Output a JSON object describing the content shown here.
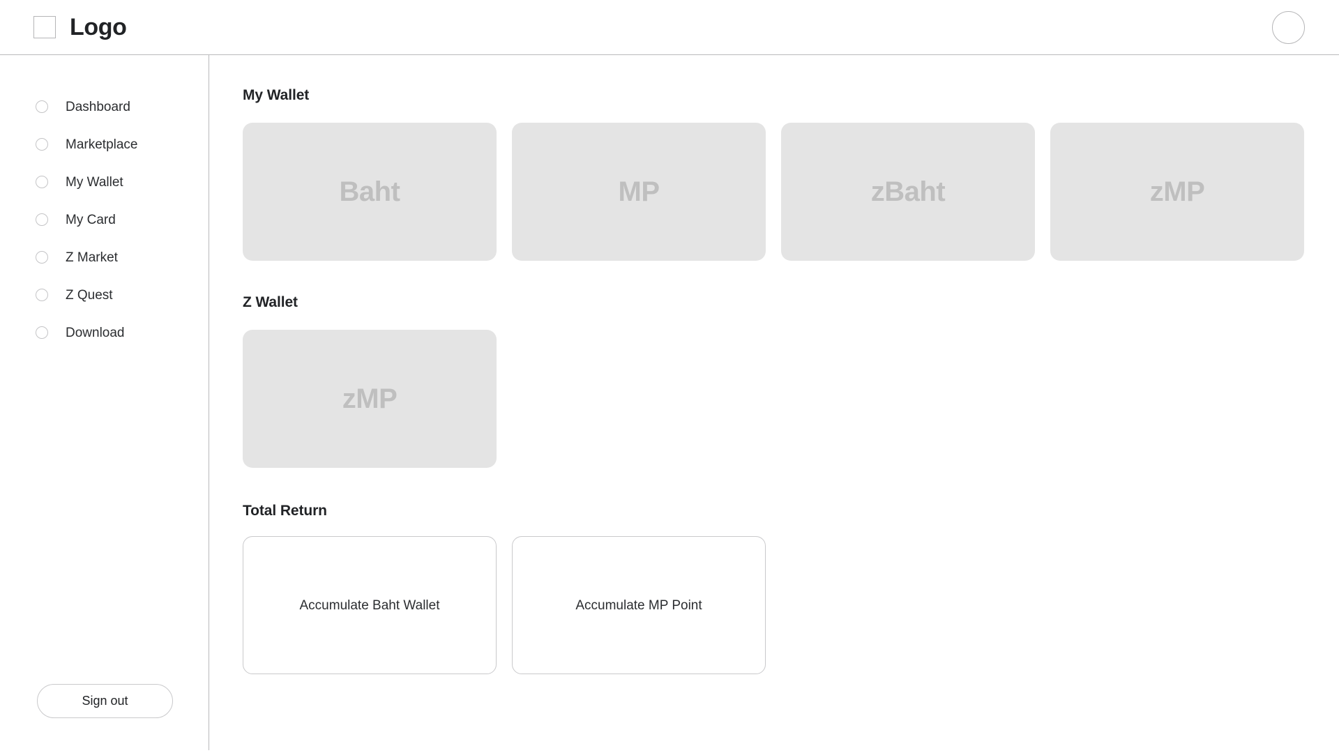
{
  "header": {
    "logo_icon": "square-placeholder-icon",
    "logo_text": "Logo",
    "avatar_icon": "user-avatar-circle"
  },
  "sidebar": {
    "items": [
      {
        "label": "Dashboard",
        "icon": "circle-bullet-icon"
      },
      {
        "label": "Marketplace",
        "icon": "circle-bullet-icon"
      },
      {
        "label": "My Wallet",
        "icon": "circle-bullet-icon"
      },
      {
        "label": "My Card",
        "icon": "circle-bullet-icon"
      },
      {
        "label": "Z Market",
        "icon": "circle-bullet-icon"
      },
      {
        "label": "Z Quest",
        "icon": "circle-bullet-icon"
      },
      {
        "label": "Download",
        "icon": "circle-bullet-icon"
      }
    ],
    "sign_out_label": "Sign out"
  },
  "main": {
    "my_wallet": {
      "title": "My Wallet",
      "cards": [
        {
          "label": "Baht"
        },
        {
          "label": "MP"
        },
        {
          "label": "zBaht"
        },
        {
          "label": "zMP"
        }
      ]
    },
    "z_wallet": {
      "title": "Z Wallet",
      "cards": [
        {
          "label": "zMP"
        }
      ]
    },
    "total_return": {
      "title": "Total Return",
      "cards": [
        {
          "label": "Accumulate Baht Wallet"
        },
        {
          "label": "Accumulate MP Point"
        }
      ]
    }
  },
  "colors": {
    "page_background": "#ffffff",
    "border": "#b9b9bb",
    "card_background": "#e4e4e4",
    "card_label": "#bfbfbf",
    "text_primary": "#212326",
    "text_secondary": "#2b2d30",
    "outline": "#c9c9cb"
  }
}
